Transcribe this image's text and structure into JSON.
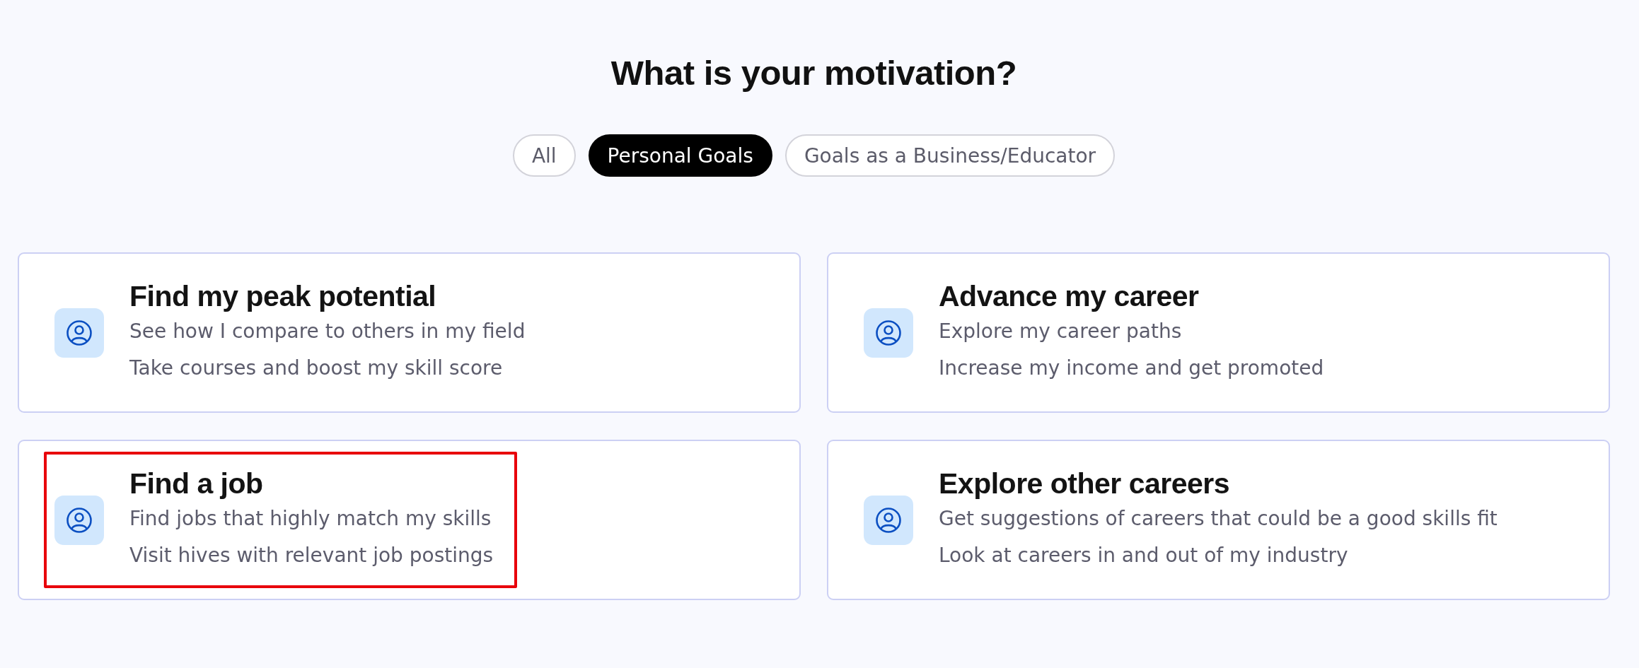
{
  "title": "What is your motivation?",
  "filters": [
    {
      "label": "All",
      "selected": false
    },
    {
      "label": "Personal Goals",
      "selected": true
    },
    {
      "label": "Goals as a Business/Educator",
      "selected": false
    }
  ],
  "goals": [
    {
      "title": "Find my peak potential",
      "lines": [
        "See how I compare to others in my field",
        "Take courses and boost my skill score"
      ],
      "highlighted": false
    },
    {
      "title": "Advance my career",
      "lines": [
        "Explore my career paths",
        "Increase my income and get promoted"
      ],
      "highlighted": false
    },
    {
      "title": "Find a job",
      "lines": [
        "Find jobs that highly match my skills",
        "Visit hives with relevant job postings"
      ],
      "highlighted": true
    },
    {
      "title": "Explore other careers",
      "lines": [
        "Get suggestions of careers that could be a good skills fit",
        "Look at careers in and out of my industry"
      ],
      "highlighted": false
    }
  ]
}
